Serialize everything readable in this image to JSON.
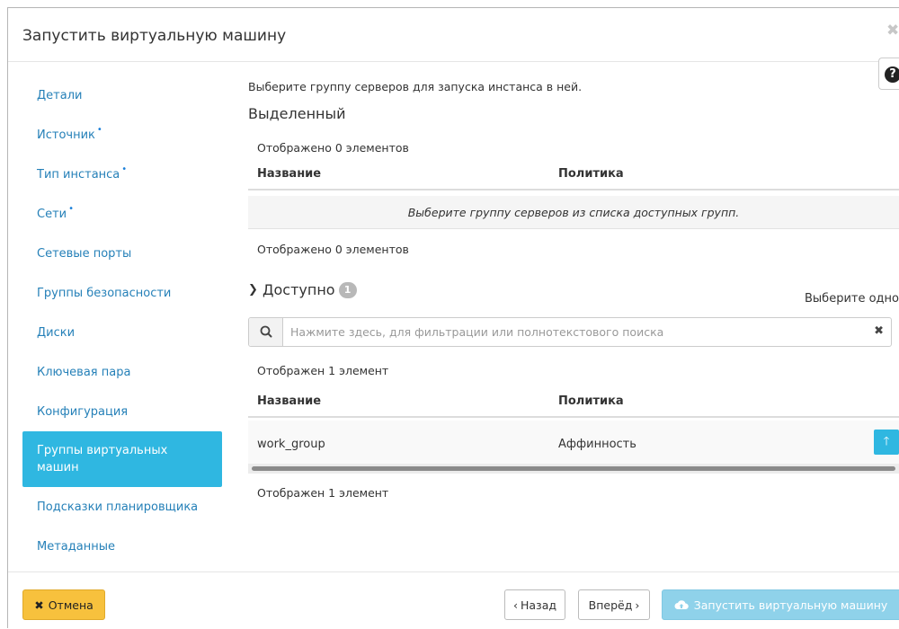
{
  "dialog": {
    "title": "Запустить виртуальную машину",
    "close_icon": "close-icon",
    "help_icon": "question-circle-icon"
  },
  "nav": {
    "items": [
      {
        "label": "Детали",
        "required": false
      },
      {
        "label": "Источник",
        "required": true
      },
      {
        "label": "Тип инстанса",
        "required": true
      },
      {
        "label": "Сети",
        "required": true
      },
      {
        "label": "Сетевые порты",
        "required": false
      },
      {
        "label": "Группы безопасности",
        "required": false
      },
      {
        "label": "Диски",
        "required": false
      },
      {
        "label": "Ключевая пара",
        "required": false
      },
      {
        "label": "Конфигурация",
        "required": false
      },
      {
        "label": "Группы виртуальных машин",
        "required": false,
        "active": true
      },
      {
        "label": "Подсказки планировщика",
        "required": false
      },
      {
        "label": "Метаданные",
        "required": false
      }
    ],
    "required_marker": "•",
    "active_color": "#2fb7e1",
    "link_color": "#2580b8"
  },
  "allocated": {
    "intro": "Выберите группу серверов для запуска инстанса в ней.",
    "title": "Выделенный",
    "count_top": "Отображено 0 элементов",
    "columns": [
      "Название",
      "Политика"
    ],
    "empty_message": "Выберите группу серверов из списка доступных групп.",
    "count_bottom": "Отображено 0 элементов"
  },
  "available": {
    "title": "Доступно",
    "badge": "1",
    "hint": "Выберите одно",
    "search_placeholder": "Нажмите здесь, для фильтрации или полнотекстового поиска",
    "search_value": "",
    "count_top": "Отображен 1 элемент",
    "columns": [
      "Название",
      "Политика"
    ],
    "rows": [
      {
        "name": "work_group",
        "policy": "Аффинность"
      }
    ],
    "count_bottom": "Отображен 1 элемент"
  },
  "footer": {
    "cancel": "Отмена",
    "back": "Назад",
    "next": "Вперёд",
    "launch": "Запустить виртуальную машину",
    "cancel_color": "#f7c13d",
    "launch_color": "#8fd2ea"
  }
}
